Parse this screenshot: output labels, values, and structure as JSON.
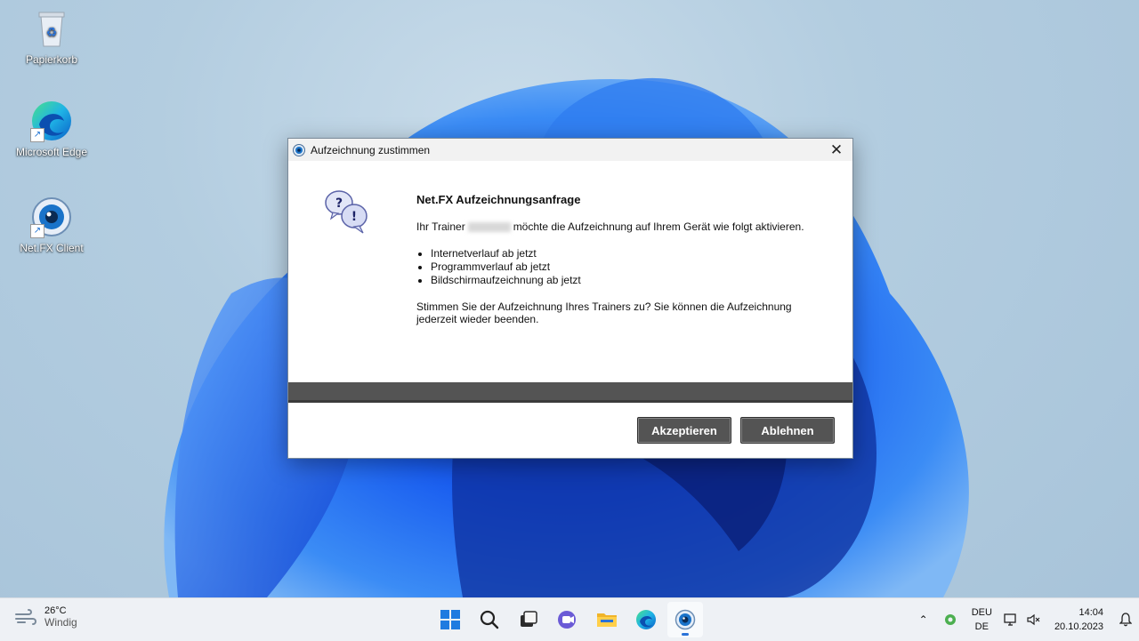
{
  "desktop": {
    "icons": [
      {
        "label": "Papierkorb",
        "icon": "recycle-bin-icon"
      },
      {
        "label": "Microsoft Edge",
        "icon": "edge-icon"
      },
      {
        "label": "Net.FX Client",
        "icon": "netfx-icon"
      }
    ]
  },
  "dialog": {
    "title": "Aufzeichnung zustimmen",
    "close_glyph": "✕",
    "heading": "Net.FX Aufzeichnungsanfrage",
    "intro_prefix": "Ihr Trainer",
    "intro_suffix": "möchte die Aufzeichnung auf Ihrem Gerät wie folgt aktivieren.",
    "items": [
      "Internetverlauf ab jetzt",
      "Programmverlauf ab jetzt",
      "Bildschirmaufzeichnung ab jetzt"
    ],
    "question": "Stimmen Sie der Aufzeichnung Ihres Trainers zu? Sie können die Aufzeichnung jederzeit wieder beenden.",
    "accept_label": "Akzeptieren",
    "decline_label": "Ablehnen"
  },
  "taskbar": {
    "weather": {
      "temp": "26°C",
      "condition": "Windig"
    },
    "apps": [
      "start-icon",
      "search-icon",
      "task-view-icon",
      "teams-chat-icon",
      "file-explorer-icon",
      "edge-icon",
      "netfx-icon"
    ],
    "tray": {
      "lang_top": "DEU",
      "lang_bottom": "DE",
      "time": "14:04",
      "date": "20.10.2023"
    }
  },
  "colors": {
    "button_bg": "#545454",
    "accent": "#2a72d8"
  }
}
